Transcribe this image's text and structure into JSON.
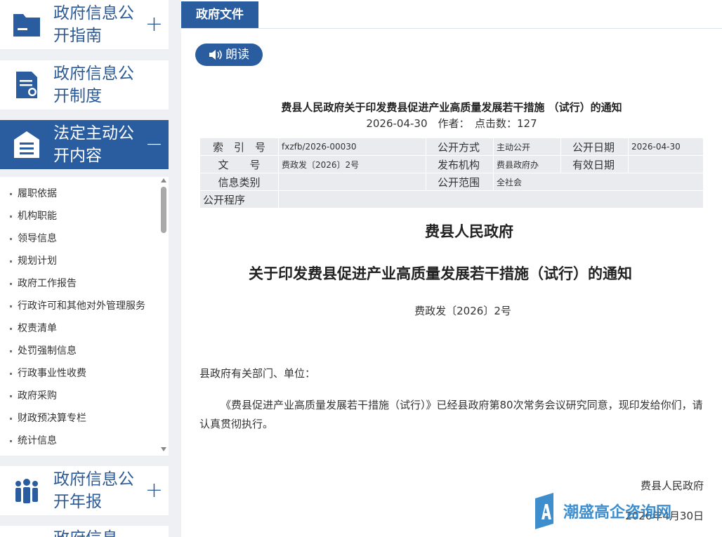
{
  "sidebar": {
    "cards": [
      {
        "title": "政府信息公开指南",
        "icon": "folder-icon",
        "toggle": "+"
      },
      {
        "title": "政府信息公开制度",
        "icon": "document-seal-icon",
        "toggle": ""
      },
      {
        "title": "法定主动公开内容",
        "icon": "clipboard-list-icon",
        "toggle": "−"
      },
      {
        "title": "政府信息公开年报",
        "icon": "people-icon",
        "toggle": "+"
      },
      {
        "title": "政府信息",
        "icon": "",
        "toggle": ""
      }
    ],
    "items": [
      "履职依据",
      "机构职能",
      "领导信息",
      "规划计划",
      "政府工作报告",
      "行政许可和其他对外管理服务",
      "权责清单",
      "处罚强制信息",
      "行政事业性收费",
      "政府采购",
      "财政预决算专栏",
      "统计信息"
    ]
  },
  "tab": "政府文件",
  "read_button": "朗读",
  "doc": {
    "title": "费县人民政府关于印发费县促进产业高质量发展若干措施 （试行）的通知",
    "meta": "2026-04-30　作者：　点击数：127"
  },
  "info": {
    "index_label": "索　引　号",
    "index_value": "fxzfb/2026-00030",
    "method_label": "公开方式",
    "method_value": "主动公开",
    "date_label": "公开日期",
    "date_value": "2026-04-30",
    "docnum_label": "文　　号",
    "docnum_value": "费政发〔2026〕2号",
    "org_label": "发布机构",
    "org_value": "费县政府办",
    "valid_label": "有效日期",
    "valid_value": "",
    "category_label": "信息类别",
    "category_value": "",
    "scope_label": "公开范围",
    "scope_value": "全社会",
    "procedure_label": "公开程序",
    "procedure_value": ""
  },
  "content": {
    "agency": "费县人民政府",
    "notice": "关于印发费县促进产业高质量发展若干措施（试行）的通知",
    "docno": "费政发〔2026〕2号",
    "salutation": "县政府有关部门、单位：",
    "body": "《费县促进产业高质量发展若干措施（试行）》已经县政府第80次常务会议研究同意，现印发给你们，请认真贯彻执行。",
    "signature": "费县人民政府",
    "date": "2026年4月30日"
  },
  "watermark": "潮盛高企咨询网",
  "colors": {
    "primary": "#2a5d9f",
    "bg": "#eef0f3",
    "info_cell": "#e9ebef"
  }
}
